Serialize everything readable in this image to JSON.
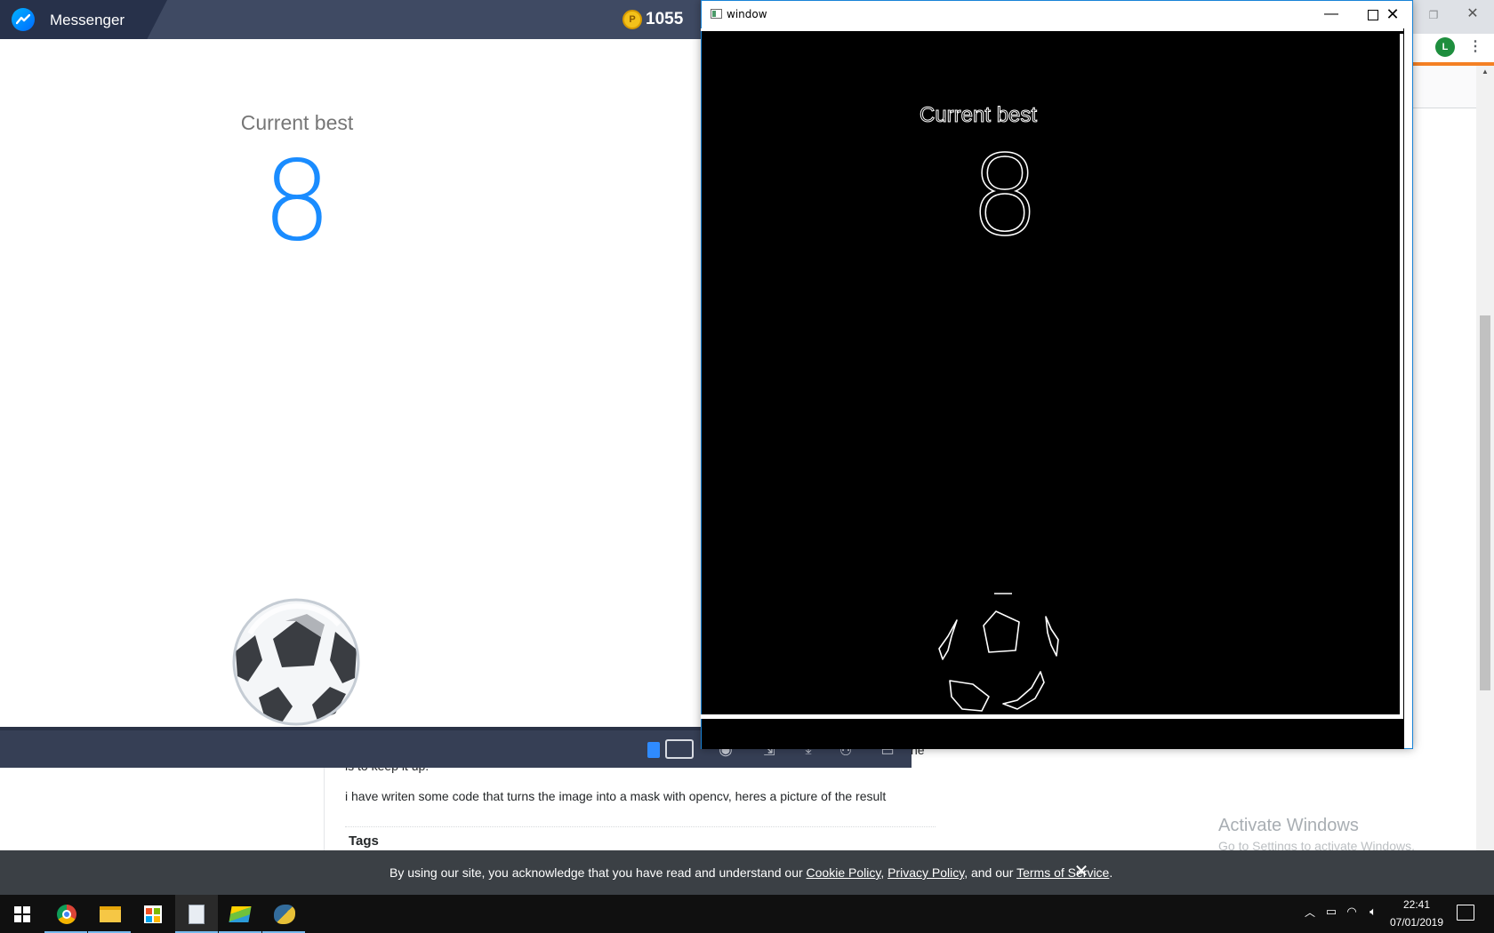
{
  "browser": {
    "profile_initial": "L",
    "post": {
      "fragment_1": "is to keep it up.",
      "fragment_2": "he",
      "main_text": "i have writen some code that turns the image into a mask with opencv, heres a picture of the result"
    },
    "tags_heading": "Tags",
    "activate_windows": {
      "title": "Activate Windows",
      "subtitle": "Go to Settings to activate Windows."
    },
    "cookie_banner": {
      "prefix": "By using our site, you acknowledge that you have read and understand our ",
      "cookie_policy": "Cookie Policy",
      "sep1": ", ",
      "privacy_policy": "Privacy Policy",
      "sep2": ", and our ",
      "terms": "Terms of Service",
      "suffix": "."
    }
  },
  "messenger": {
    "title": "Messenger",
    "coins": "1055",
    "coin_symbol": "P",
    "game": {
      "best_label": "Current best",
      "best_score": "8"
    }
  },
  "cv_window": {
    "title": "window",
    "best_label": "Current best",
    "best_score": "8"
  },
  "taskbar": {
    "apps": [
      "start",
      "chrome",
      "file-explorer",
      "store",
      "notepad",
      "bluestacks",
      "python"
    ],
    "time": "22:41",
    "date": "07/01/2019"
  },
  "colors": {
    "messenger_titlebar": "#3f4a63",
    "messenger_score": "#1a8cff",
    "cookie_banner": "#3b4045",
    "taskbar": "#101010",
    "so_accent": "#f48024"
  }
}
